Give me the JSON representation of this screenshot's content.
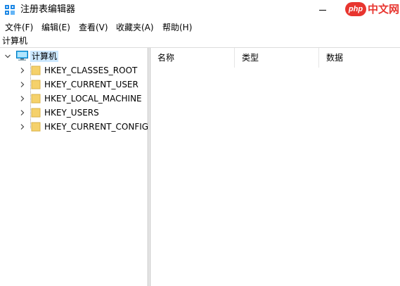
{
  "window": {
    "title": "注册表编辑器",
    "app_icon": "regedit-icon"
  },
  "watermark": {
    "logo_text": "php",
    "text": "中文网",
    "color": "#e8352f"
  },
  "menu": [
    {
      "label": "文件(F)"
    },
    {
      "label": "编辑(E)"
    },
    {
      "label": "查看(V)"
    },
    {
      "label": "收藏夹(A)"
    },
    {
      "label": "帮助(H)"
    }
  ],
  "address": "计算机",
  "tree": {
    "root": {
      "label": "计算机",
      "icon": "computer-icon",
      "expanded": true
    },
    "keys": [
      {
        "label": "HKEY_CLASSES_ROOT"
      },
      {
        "label": "HKEY_CURRENT_USER"
      },
      {
        "label": "HKEY_LOCAL_MACHINE"
      },
      {
        "label": "HKEY_USERS"
      },
      {
        "label": "HKEY_CURRENT_CONFIG"
      }
    ]
  },
  "columns": [
    {
      "label": "名称"
    },
    {
      "label": "类型"
    },
    {
      "label": "数据"
    }
  ],
  "colors": {
    "selection": "#cce8ff",
    "folder": "#f5d16b"
  }
}
